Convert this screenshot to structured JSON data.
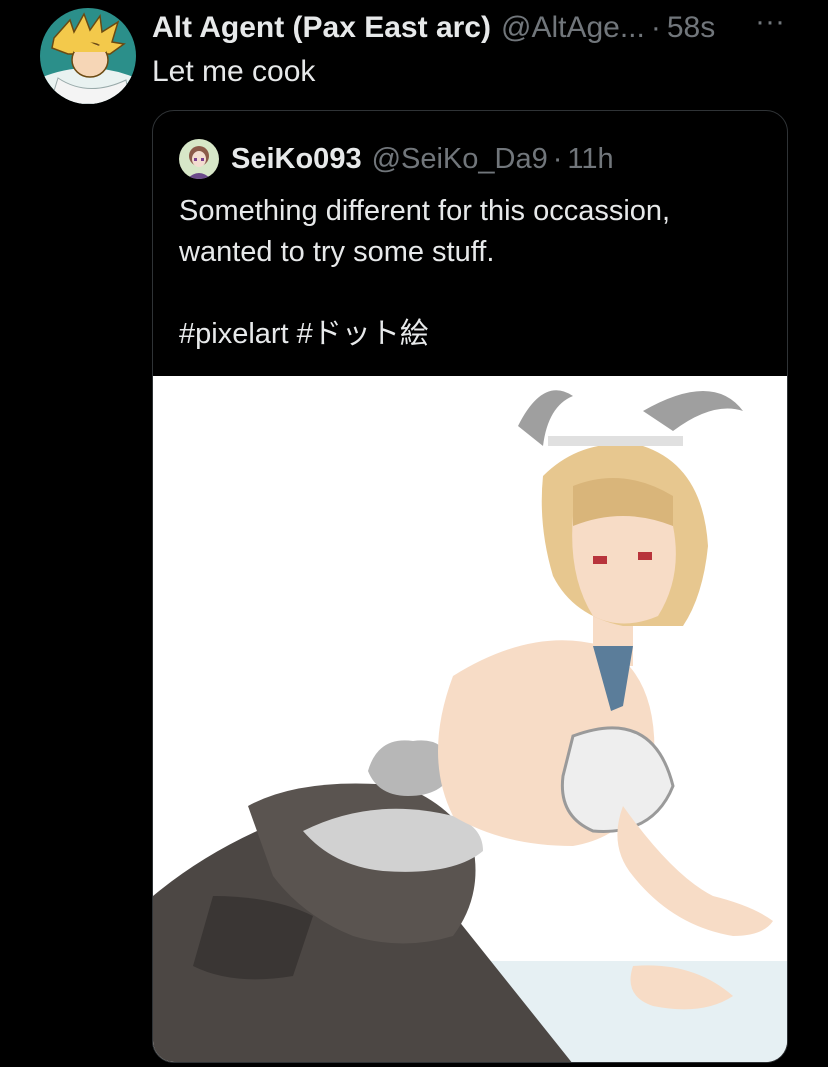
{
  "tweet": {
    "author_name": "Alt Agent (Pax East arc)",
    "author_handle": "@AltAge...",
    "separator": "·",
    "timestamp": "58s",
    "more_label": "···",
    "text": "Let me cook"
  },
  "quoted_tweet": {
    "author_name": "SeiKo093",
    "author_handle": "@SeiKo_Da9",
    "separator": "·",
    "timestamp": "11h",
    "text_lines": [
      "Something different for this occassion,",
      "wanted to try some stuff."
    ],
    "hashtags": "#pixelart #ドット絵"
  },
  "colors": {
    "background": "#000000",
    "text_primary": "#e7e9ea",
    "text_secondary": "#71767b",
    "border": "#2f3336"
  },
  "icons": {
    "more": "more-horizontal-icon",
    "author_avatar": "anime-character-avatar",
    "quoted_avatar": "pixel-character-avatar"
  }
}
